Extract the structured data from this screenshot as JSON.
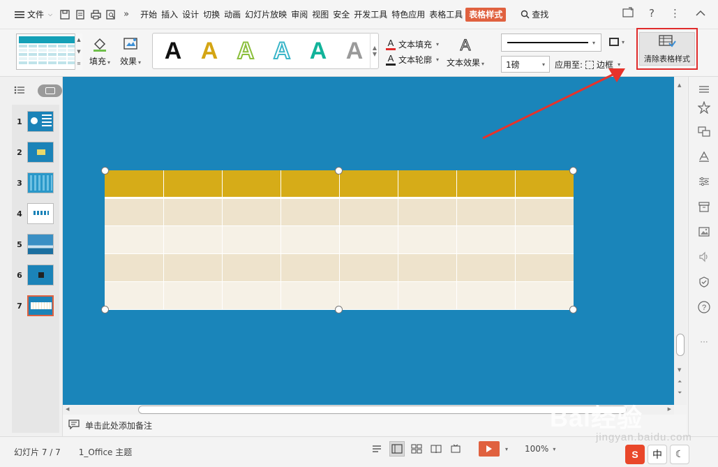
{
  "menubar": {
    "file_label": "文件",
    "tabs": [
      "开始",
      "插入",
      "设计",
      "切换",
      "动画",
      "幻灯片放映",
      "审阅",
      "视图",
      "安全",
      "开发工具",
      "特色应用",
      "表格工具",
      "表格样式"
    ],
    "active_tab": "表格样式",
    "search_label": "查找"
  },
  "ribbon": {
    "fill_label": "填充",
    "effect_label": "效果",
    "wordart_colors": [
      "#000000",
      "#d4a514",
      "#8bbf3c",
      "#3bb6c9",
      "#12b39a",
      "#8a8a8a"
    ],
    "text_fill_label": "文本填充",
    "text_outline_label": "文本轮廓",
    "text_effect_label": "文本效果",
    "line_weight_value": "1磅",
    "apply_to_label": "应用至:",
    "apply_to_value": "边框",
    "clear_style_label": "清除表格样式"
  },
  "left_panel": {
    "slide_numbers": [
      "1",
      "2",
      "3",
      "4",
      "5",
      "6",
      "7"
    ],
    "active_slide": "7"
  },
  "slide": {
    "table": {
      "columns": 8,
      "rows": 5,
      "header_color": "#d6ac18",
      "band_color_1": "#eee3cc",
      "band_color_2": "#f6f1e6",
      "background": "#1a85ba"
    }
  },
  "notes": {
    "placeholder": "单击此处添加备注"
  },
  "status": {
    "slide_info": "幻灯片 7 / 7",
    "theme": "1_Office 主题",
    "zoom": "100%"
  },
  "ime": {
    "mode": "中"
  },
  "watermark": {
    "text": "Bai经验",
    "sub": "jingyan.baidu.com"
  },
  "colors": {
    "accent": "#e0613f",
    "highlight_box": "#e02b2b"
  }
}
